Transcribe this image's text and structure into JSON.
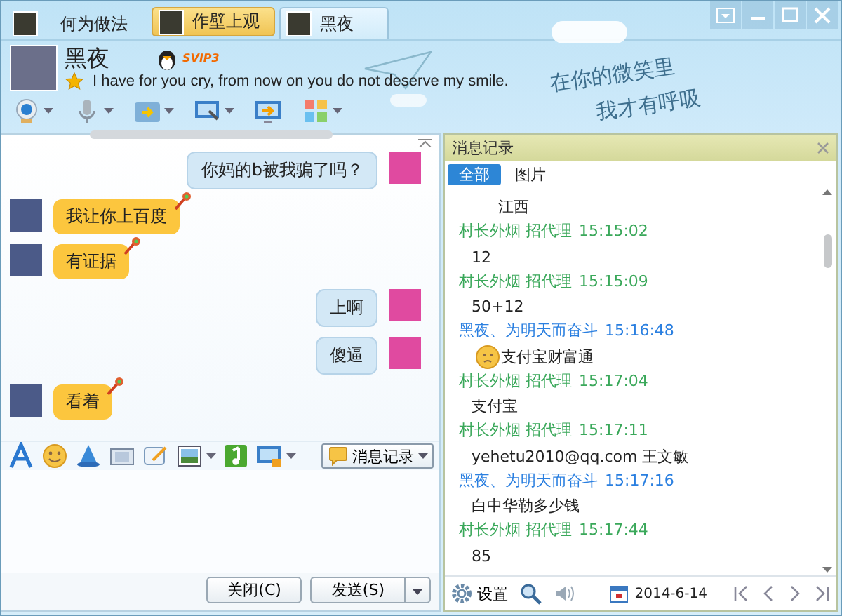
{
  "tabs": [
    {
      "label": "何为做法",
      "selected": false,
      "unread": false
    },
    {
      "label": "作壁上观",
      "selected": false,
      "unread": true
    },
    {
      "label": "黑夜",
      "selected": true,
      "unread": false
    }
  ],
  "contact": {
    "name": "黑夜",
    "badge": "SVIP3",
    "signature": "I have for you cry, from now on you do not deserve my smile."
  },
  "decoration": {
    "lines": [
      "在你的微笑里",
      "我才有呼吸"
    ]
  },
  "messages": [
    {
      "outgoing": true,
      "text": "你妈的b被我骗了吗？"
    },
    {
      "outgoing": false,
      "text": "我让你上百度"
    },
    {
      "outgoing": false,
      "text": "有证据"
    },
    {
      "outgoing": true,
      "text": "上啊"
    },
    {
      "outgoing": true,
      "text": "傻逼"
    },
    {
      "outgoing": false,
      "text": "看着"
    }
  ],
  "input_toolbar": {
    "history_button": "消息记录"
  },
  "buttons": {
    "close": "关闭(C)",
    "send": "发送(S)"
  },
  "history": {
    "title": "消息记录",
    "tabs": [
      {
        "label": "全部",
        "selected": true
      },
      {
        "label": "图片",
        "selected": false
      }
    ],
    "entries": [
      {
        "kind": "text",
        "text": "江西"
      },
      {
        "kind": "text",
        "sender": "村长外烟  招代理",
        "time": "15:15:02",
        "color": "#3aa85a",
        "text": "12"
      },
      {
        "kind": "text",
        "sender": "村长外烟  招代理",
        "time": "15:15:09",
        "color": "#3aa85a",
        "text": "50+12"
      },
      {
        "kind": "emoji",
        "sender": "黑夜、为明天而奋斗",
        "time": "15:16:48",
        "color": "#2a7fe0",
        "text": "支付宝财富通"
      },
      {
        "kind": "text",
        "sender": "村长外烟  招代理",
        "time": "15:17:04",
        "color": "#3aa85a",
        "text": "支付宝"
      },
      {
        "kind": "text",
        "sender": "村长外烟  招代理",
        "time": "15:17:11",
        "color": "#3aa85a",
        "text": "yehetu2010@qq.com  王文敏"
      },
      {
        "kind": "text",
        "sender": "黑夜、为明天而奋斗",
        "time": "15:17:16",
        "color": "#2a7fe0",
        "text": "白中华勒多少钱"
      },
      {
        "kind": "text",
        "sender": "村长外烟  招代理",
        "time": "15:17:44",
        "color": "#3aa85a",
        "text": "85"
      }
    ],
    "footer": {
      "settings": "设置",
      "date": "2014-6-14"
    }
  }
}
